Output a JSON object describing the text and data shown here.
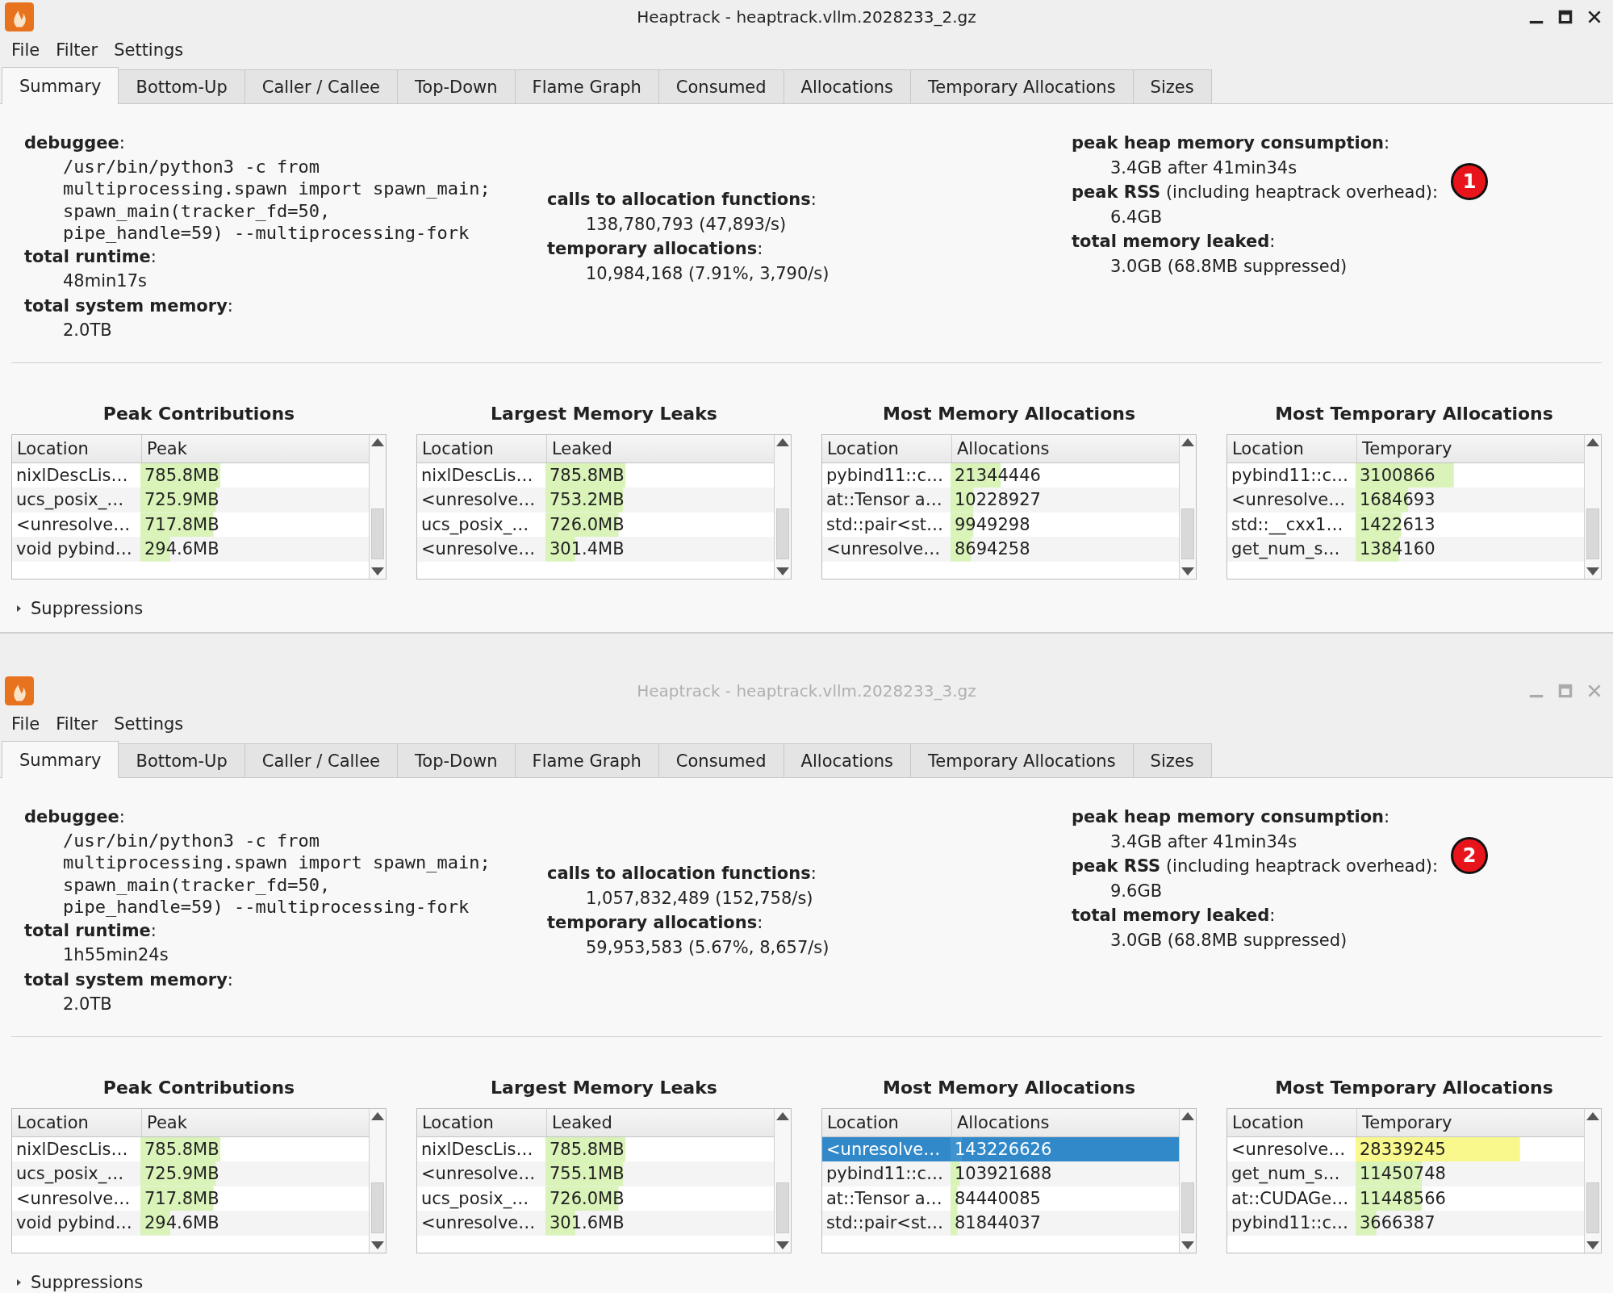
{
  "windows": [
    {
      "title": "Heaptrack - heaptrack.vllm.2028233_2.gz",
      "active": true,
      "menu": [
        "File",
        "Filter",
        "Settings"
      ],
      "tabs": [
        {
          "label": "Summary",
          "selected": true
        },
        {
          "label": "Bottom-Up",
          "selected": false
        },
        {
          "label": "Caller / Callee",
          "selected": false
        },
        {
          "label": "Top-Down",
          "selected": false
        },
        {
          "label": "Flame Graph",
          "selected": false
        },
        {
          "label": "Consumed",
          "selected": false
        },
        {
          "label": "Allocations",
          "selected": false
        },
        {
          "label": "Temporary Allocations",
          "selected": false
        },
        {
          "label": "Sizes",
          "selected": false
        }
      ],
      "summary": [
        [
          {
            "label": "**debuggee**:",
            "kind": "mono",
            "lines": [
              "/usr/bin/python3 -c from",
              "multiprocessing.spawn import spawn_main;",
              "spawn_main(tracker_fd=50,",
              "pipe_handle=59) --multiprocessing-fork"
            ]
          },
          {
            "label": "**total runtime**:",
            "kind": "text",
            "lines": [
              "48min17s"
            ]
          },
          {
            "label": "**total system memory**:",
            "kind": "text",
            "lines": [
              "2.0TB"
            ]
          }
        ],
        [
          {
            "label": "**calls to allocation functions**:",
            "kind": "text",
            "lines": [
              "138,780,793 (47,893/s)"
            ]
          },
          {
            "label": "**temporary allocations**:",
            "kind": "text",
            "lines": [
              "10,984,168 (7.91%, 3,790/s)"
            ]
          }
        ],
        [
          {
            "label": "**peak heap memory consumption**:",
            "kind": "text",
            "lines": [
              "3.4GB after 41min34s"
            ]
          },
          {
            "label": "**peak RSS** (including heaptrack overhead):",
            "kind": "text",
            "lines": [
              "6.4GB"
            ]
          },
          {
            "label": "**total memory leaked**:",
            "kind": "text",
            "lines": [
              "3.0GB (68.8MB suppressed)"
            ]
          }
        ]
      ],
      "badge": "1",
      "tables": [
        {
          "title": "Peak Contributions",
          "columns": [
            "Location",
            "Peak"
          ],
          "rows": [
            {
              "location": "nixlDescLis…",
              "value": "785.8MB",
              "level": 0.35,
              "selected": false
            },
            {
              "location": "ucs_posix_…",
              "value": "725.9MB",
              "level": 0.33,
              "selected": false
            },
            {
              "location": "<unresolve…",
              "value": "717.8MB",
              "level": 0.32,
              "selected": false
            },
            {
              "location": "void pybind…",
              "value": "294.6MB",
              "level": 0.13,
              "selected": false
            }
          ]
        },
        {
          "title": "Largest Memory Leaks",
          "columns": [
            "Location",
            "Leaked"
          ],
          "rows": [
            {
              "location": "nixlDescLis…",
              "value": "785.8MB",
              "level": 0.35,
              "selected": false
            },
            {
              "location": "<unresolve…",
              "value": "753.2MB",
              "level": 0.34,
              "selected": false
            },
            {
              "location": "ucs_posix_…",
              "value": "726.0MB",
              "level": 0.32,
              "selected": false
            },
            {
              "location": "<unresolve…",
              "value": "301.4MB",
              "level": 0.13,
              "selected": false
            }
          ]
        },
        {
          "title": "Most Memory Allocations",
          "columns": [
            "Location",
            "Allocations"
          ],
          "rows": [
            {
              "location": "pybind11::c…",
              "value": "21344446",
              "level": 0.22,
              "selected": false
            },
            {
              "location": "at::Tensor a…",
              "value": "10228927",
              "level": 0.1,
              "selected": false
            },
            {
              "location": "std::pair<st…",
              "value": "9949298",
              "level": 0.1,
              "selected": false
            },
            {
              "location": "<unresolve…",
              "value": "8694258",
              "level": 0.09,
              "selected": false
            }
          ]
        },
        {
          "title": "Most Temporary Allocations",
          "columns": [
            "Location",
            "Temporary"
          ],
          "rows": [
            {
              "location": "pybind11::c…",
              "value": "3100866",
              "level": 0.43,
              "selected": false
            },
            {
              "location": "<unresolve…",
              "value": "1684693",
              "level": 0.23,
              "selected": false
            },
            {
              "location": "std::__cxx1…",
              "value": "1422613",
              "level": 0.2,
              "selected": false
            },
            {
              "location": "get_num_s…",
              "value": "1384160",
              "level": 0.19,
              "selected": false
            }
          ]
        }
      ],
      "suppressions": {
        "label": "Suppressions",
        "expanded": false
      }
    },
    {
      "title": "Heaptrack - heaptrack.vllm.2028233_3.gz",
      "active": false,
      "menu": [
        "File",
        "Filter",
        "Settings"
      ],
      "tabs": [
        {
          "label": "Summary",
          "selected": true
        },
        {
          "label": "Bottom-Up",
          "selected": false
        },
        {
          "label": "Caller / Callee",
          "selected": false
        },
        {
          "label": "Top-Down",
          "selected": false
        },
        {
          "label": "Flame Graph",
          "selected": false
        },
        {
          "label": "Consumed",
          "selected": false
        },
        {
          "label": "Allocations",
          "selected": false
        },
        {
          "label": "Temporary Allocations",
          "selected": false
        },
        {
          "label": "Sizes",
          "selected": false
        }
      ],
      "summary": [
        [
          {
            "label": "**debuggee**:",
            "kind": "mono",
            "lines": [
              "/usr/bin/python3 -c from",
              "multiprocessing.spawn import spawn_main;",
              "spawn_main(tracker_fd=50,",
              "pipe_handle=59) --multiprocessing-fork"
            ]
          },
          {
            "label": "**total runtime**:",
            "kind": "text",
            "lines": [
              "1h55min24s"
            ]
          },
          {
            "label": "**total system memory**:",
            "kind": "text",
            "lines": [
              "2.0TB"
            ]
          }
        ],
        [
          {
            "label": "**calls to allocation functions**:",
            "kind": "text",
            "lines": [
              "1,057,832,489 (152,758/s)"
            ]
          },
          {
            "label": "**temporary allocations**:",
            "kind": "text",
            "lines": [
              "59,953,583 (5.67%, 8,657/s)"
            ]
          }
        ],
        [
          {
            "label": "**peak heap memory consumption**:",
            "kind": "text",
            "lines": [
              "3.4GB after 41min34s"
            ]
          },
          {
            "label": "**peak RSS** (including heaptrack overhead):",
            "kind": "text",
            "lines": [
              "9.6GB"
            ]
          },
          {
            "label": "**total memory leaked**:",
            "kind": "text",
            "lines": [
              "3.0GB (68.8MB suppressed)"
            ]
          }
        ]
      ],
      "badge": "2",
      "tables": [
        {
          "title": "Peak Contributions",
          "columns": [
            "Location",
            "Peak"
          ],
          "rows": [
            {
              "location": "nixlDescLis…",
              "value": "785.8MB",
              "level": 0.35,
              "selected": false
            },
            {
              "location": "ucs_posix_…",
              "value": "725.9MB",
              "level": 0.33,
              "selected": false
            },
            {
              "location": "<unresolve…",
              "value": "717.8MB",
              "level": 0.32,
              "selected": false
            },
            {
              "location": "void pybind…",
              "value": "294.6MB",
              "level": 0.13,
              "selected": false
            }
          ]
        },
        {
          "title": "Largest Memory Leaks",
          "columns": [
            "Location",
            "Leaked"
          ],
          "rows": [
            {
              "location": "nixlDescLis…",
              "value": "785.8MB",
              "level": 0.35,
              "selected": false
            },
            {
              "location": "<unresolve…",
              "value": "755.1MB",
              "level": 0.34,
              "selected": false
            },
            {
              "location": "ucs_posix_…",
              "value": "726.0MB",
              "level": 0.32,
              "selected": false
            },
            {
              "location": "<unresolve…",
              "value": "301.6MB",
              "level": 0.13,
              "selected": false
            }
          ]
        },
        {
          "title": "Most Memory Allocations",
          "columns": [
            "Location",
            "Allocations"
          ],
          "rows": [
            {
              "location": "<unresolve…",
              "value": "143226626",
              "level": 0.05,
              "selected": true
            },
            {
              "location": "pybind11::c…",
              "value": "103921688",
              "level": 0.04,
              "selected": false
            },
            {
              "location": "at::Tensor a…",
              "value": "84440085",
              "level": 0.03,
              "selected": false
            },
            {
              "location": "std::pair<st…",
              "value": "81844037",
              "level": 0.03,
              "selected": false
            }
          ]
        },
        {
          "title": "Most Temporary Allocations",
          "columns": [
            "Location",
            "Temporary"
          ],
          "rows": [
            {
              "location": "<unresolve…",
              "value": "28339245",
              "level": 0.72,
              "selected": false,
              "highlighted": true
            },
            {
              "location": "get_num_s…",
              "value": "11450748",
              "level": 0.29,
              "selected": false,
              "highlighted": false
            },
            {
              "location": "at::CUDAGe…",
              "value": "11448566",
              "level": 0.29,
              "selected": false,
              "highlighted": false
            },
            {
              "location": "pybind11::c…",
              "value": "3666387",
              "level": 0.09,
              "selected": false,
              "highlighted": false
            }
          ]
        }
      ],
      "suppressions": {
        "label": "Suppressions",
        "expanded": false
      }
    }
  ]
}
